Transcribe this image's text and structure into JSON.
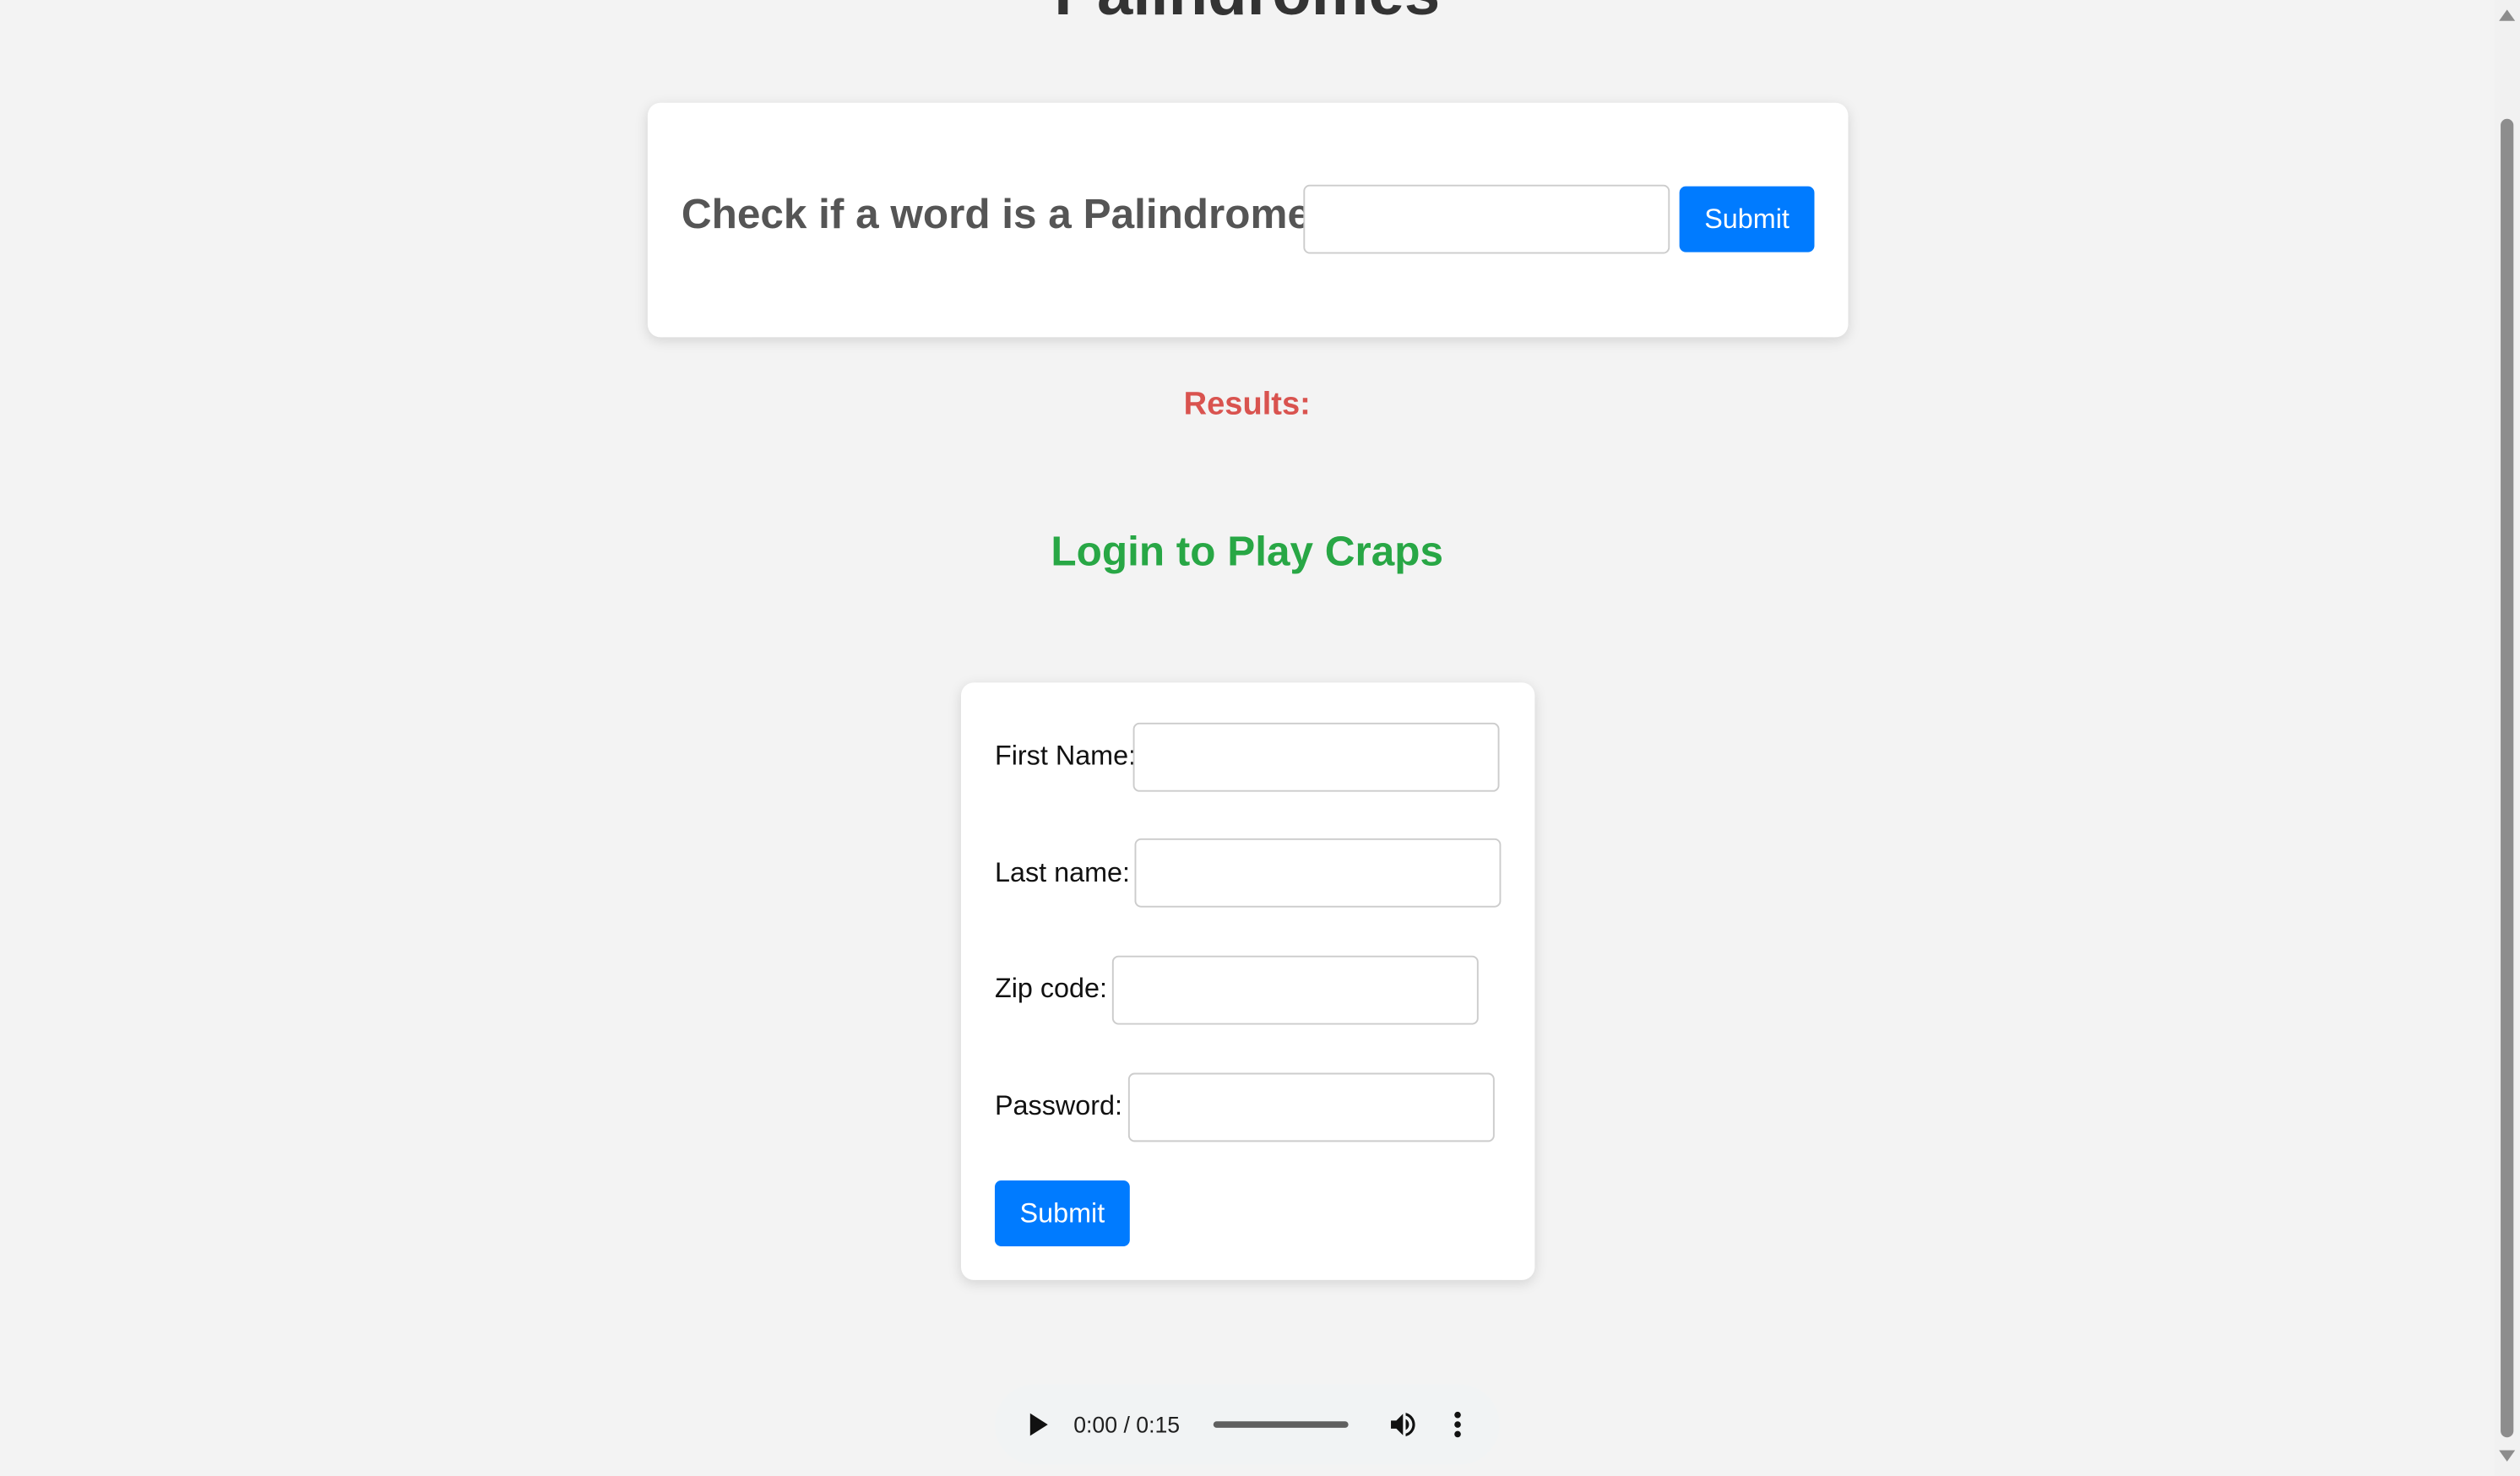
{
  "page": {
    "title": "Palindromes"
  },
  "palindrome": {
    "label": "Check if a word is a Palindrome",
    "input_value": "",
    "submit_label": "Submit"
  },
  "results": {
    "label": "Results:"
  },
  "craps": {
    "heading": "Login to Play Craps",
    "first_name_label": "First Name:",
    "first_name_value": "",
    "last_name_label": "Last name:",
    "last_name_value": "",
    "zip_label": "Zip code:",
    "zip_value": "",
    "password_label": "Password:",
    "password_value": "",
    "submit_label": "Submit"
  },
  "audio": {
    "time": "0:00 / 0:15",
    "progress": 0,
    "play_icon": "play-icon",
    "volume_icon": "volume-icon",
    "more_icon": "more-vertical-icon"
  },
  "colors": {
    "background": "#f3f3f3",
    "button": "#007bff",
    "results": "#d9534f",
    "heading": "#28a745"
  }
}
